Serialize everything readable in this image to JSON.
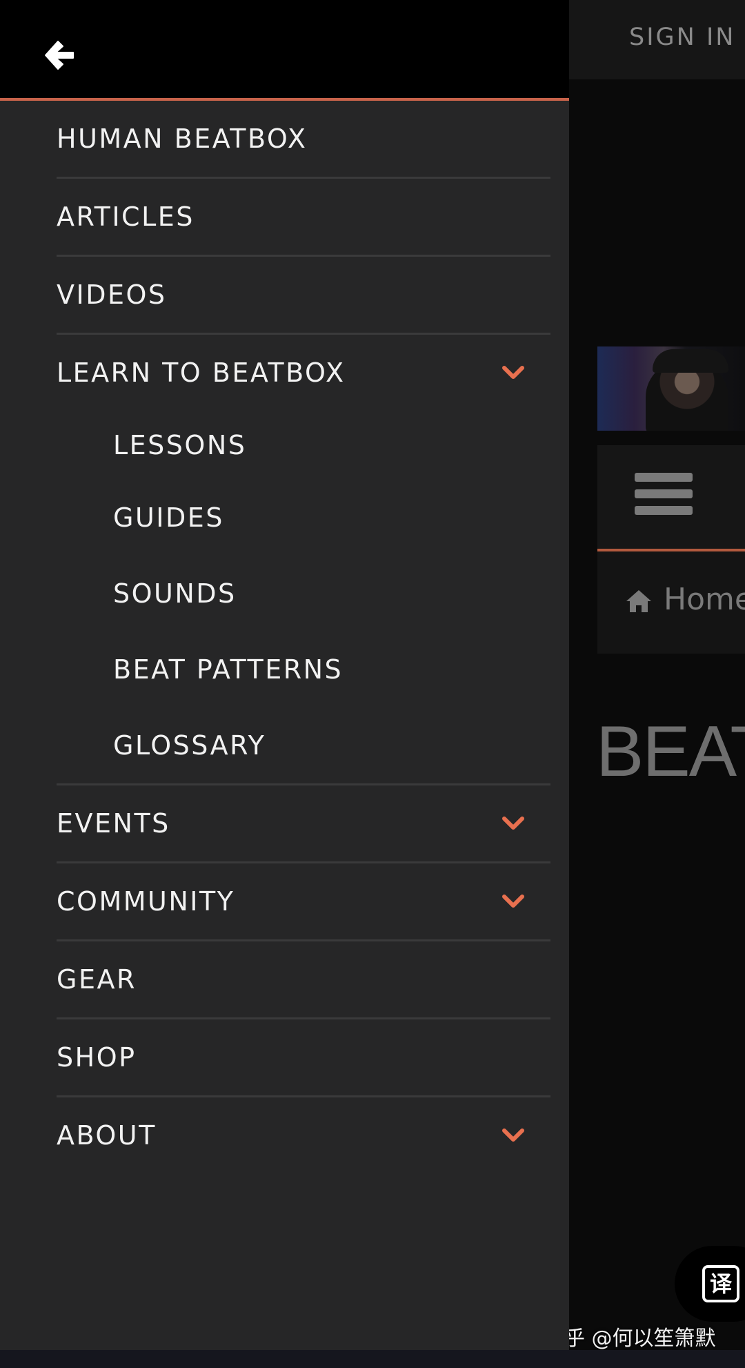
{
  "background": {
    "signin_label": "SIGN IN",
    "breadcrumb_home": "Home",
    "title_fragment": "BEAT",
    "translate_label": "译",
    "watermark": "知乎 @何以笙箫默"
  },
  "drawer": {
    "accent_color": "#c8634a",
    "items": [
      {
        "label": "HUMAN BEATBOX",
        "has_children": false
      },
      {
        "label": "ARTICLES",
        "has_children": false
      },
      {
        "label": "VIDEOS",
        "has_children": false
      },
      {
        "label": "LEARN TO BEATBOX",
        "has_children": true,
        "expanded": true,
        "children": [
          "LESSONS",
          "GUIDES",
          "SOUNDS",
          "BEAT PATTERNS",
          "GLOSSARY"
        ]
      },
      {
        "label": "EVENTS",
        "has_children": true,
        "expanded": false
      },
      {
        "label": "COMMUNITY",
        "has_children": true,
        "expanded": false
      },
      {
        "label": "GEAR",
        "has_children": false
      },
      {
        "label": "SHOP",
        "has_children": false
      },
      {
        "label": "ABOUT",
        "has_children": true,
        "expanded": false
      }
    ]
  },
  "icons": {
    "back": "arrow-left-icon",
    "chevron": "chevron-down-icon",
    "home": "home-icon",
    "menu": "hamburger-icon"
  }
}
